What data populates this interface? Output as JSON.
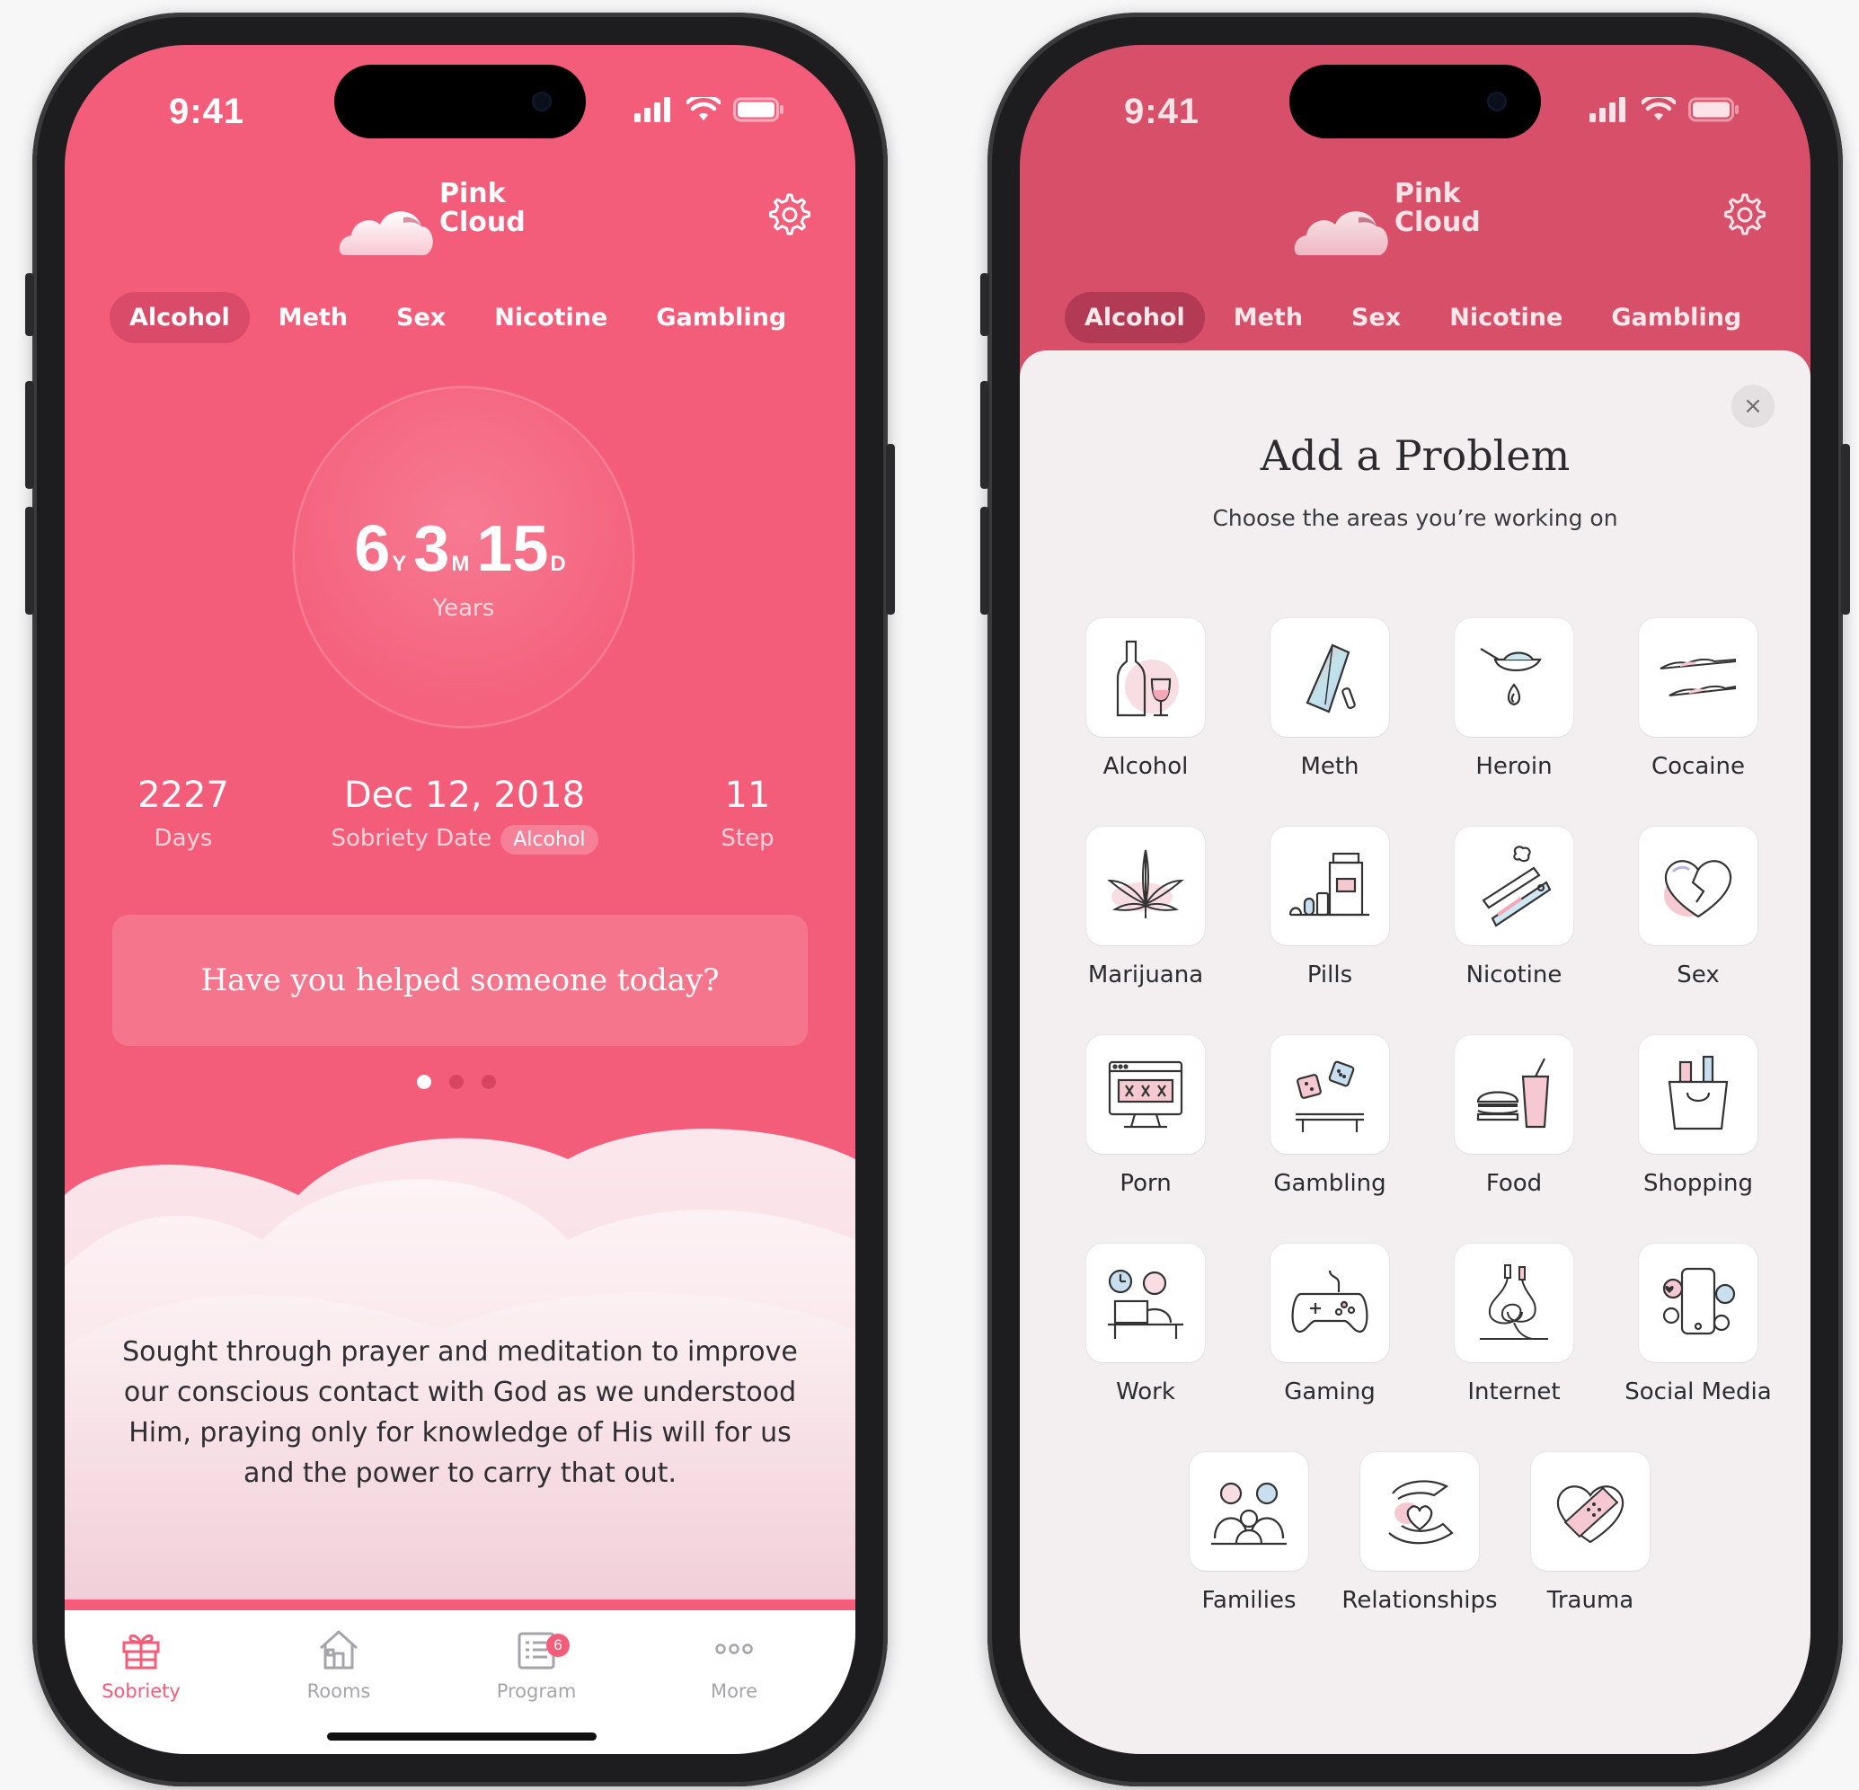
{
  "status": {
    "time": "9:41"
  },
  "app": {
    "logo_line1": "Pink",
    "logo_line2": "Cloud"
  },
  "tabs": [
    "Alcohol",
    "Meth",
    "Sex",
    "Nicotine",
    "Gambling"
  ],
  "counter": {
    "years": "6",
    "y": "Y",
    "months": "3",
    "m": "M",
    "days": "15",
    "d": "D",
    "label": "Years"
  },
  "stats": {
    "days_value": "2227",
    "days_label": "Days",
    "date_value": "Dec 12, 2018",
    "date_label": "Sobriety Date",
    "date_pill": "Alcohol",
    "step_value": "11",
    "step_label": "Step"
  },
  "card": {
    "text": "Have you helped someone today?"
  },
  "quote": "Sought through prayer and meditation to improve our conscious contact with God as we understood Him, praying only for knowledge of His will for us and the power to carry that out.",
  "nav": {
    "sobriety": "Sobriety",
    "rooms": "Rooms",
    "program": "Program",
    "program_badge": "6",
    "more": "More"
  },
  "sheet": {
    "close": "×",
    "title": "Add a Problem",
    "subtitle": "Choose the areas you’re working on",
    "items": [
      "Alcohol",
      "Meth",
      "Heroin",
      "Cocaine",
      "Marijuana",
      "Pills",
      "Nicotine",
      "Sex",
      "Porn",
      "Gambling",
      "Food",
      "Shopping",
      "Work",
      "Gaming",
      "Internet",
      "Social Media",
      "Families",
      "Relationships",
      "Trauma"
    ]
  },
  "colors": {
    "primary": "#f45d7a",
    "primary_dark": "#d84f69",
    "sheet_bg": "#f3eff1",
    "text_dark": "#2b2b30"
  }
}
